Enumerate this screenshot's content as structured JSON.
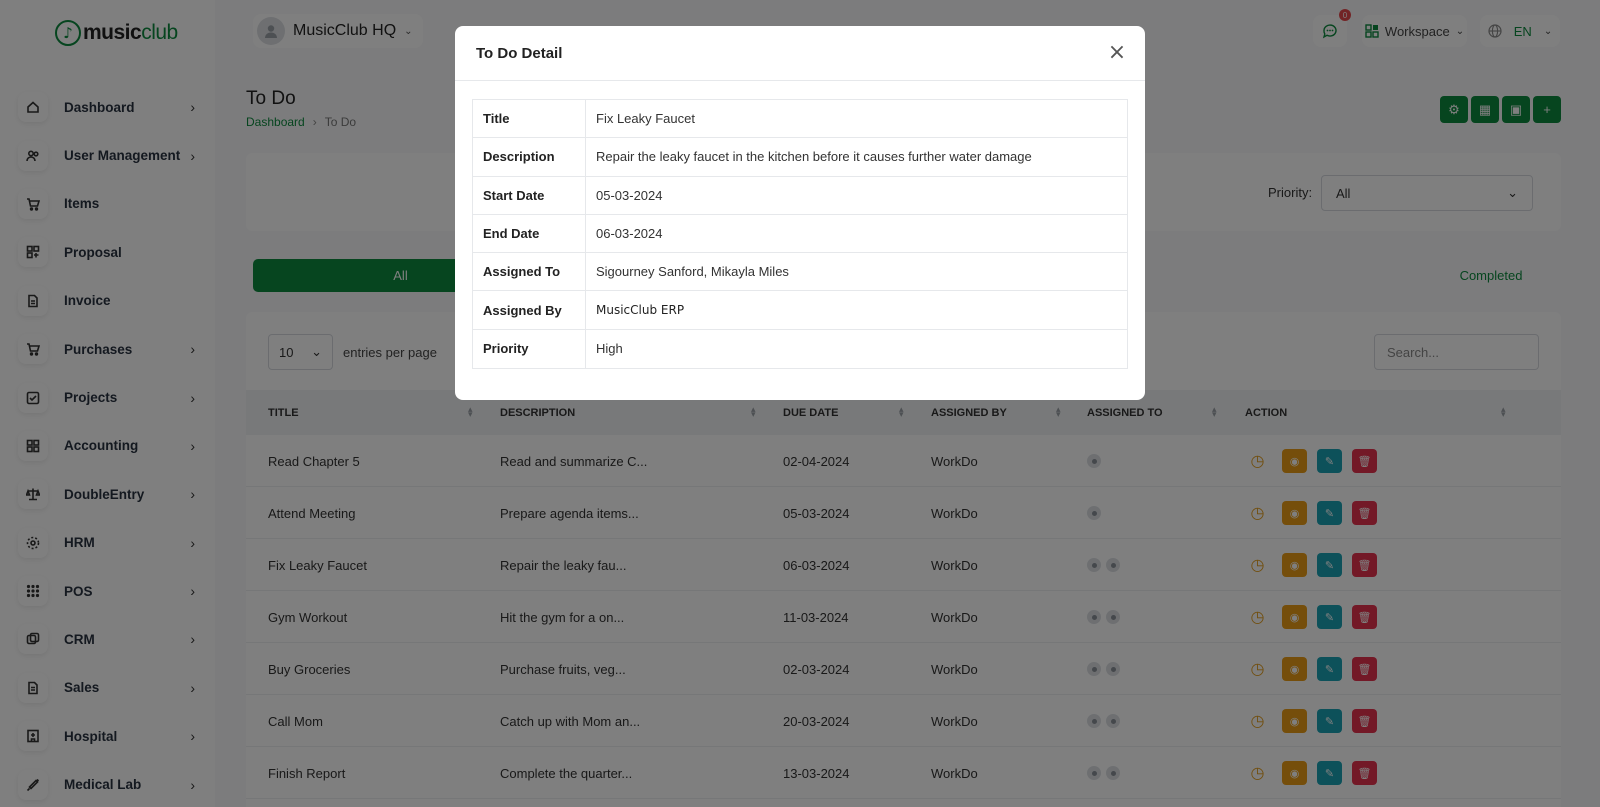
{
  "brand": {
    "logo_part1": "music",
    "logo_part2": "club"
  },
  "header": {
    "workspace_name": "MusicClub HQ",
    "notifications_count": "0",
    "workspace_label": "Workspace",
    "language": "EN"
  },
  "sidebar": {
    "items": [
      {
        "label": "Dashboard",
        "icon": "home-icon",
        "chevron": true
      },
      {
        "label": "User Management",
        "icon": "users-icon",
        "chevron": true
      },
      {
        "label": "Items",
        "icon": "cart-icon",
        "chevron": false
      },
      {
        "label": "Proposal",
        "icon": "proposal-icon",
        "chevron": false
      },
      {
        "label": "Invoice",
        "icon": "invoice-icon",
        "chevron": false
      },
      {
        "label": "Purchases",
        "icon": "cart-icon",
        "chevron": true
      },
      {
        "label": "Projects",
        "icon": "check-square-icon",
        "chevron": true
      },
      {
        "label": "Accounting",
        "icon": "grid-icon",
        "chevron": true
      },
      {
        "label": "DoubleEntry",
        "icon": "scale-icon",
        "chevron": true
      },
      {
        "label": "HRM",
        "icon": "hrm-icon",
        "chevron": true
      },
      {
        "label": "POS",
        "icon": "dots-grid-icon",
        "chevron": true
      },
      {
        "label": "CRM",
        "icon": "crm-icon",
        "chevron": true
      },
      {
        "label": "Sales",
        "icon": "file-icon",
        "chevron": true
      },
      {
        "label": "Hospital",
        "icon": "hospital-icon",
        "chevron": true
      },
      {
        "label": "Medical Lab",
        "icon": "syringe-icon",
        "chevron": true
      }
    ]
  },
  "page": {
    "title": "To Do",
    "breadcrumb": [
      "Dashboard",
      "To Do"
    ]
  },
  "filter": {
    "priority_label": "Priority:",
    "priority_value": "All"
  },
  "tabs": {
    "all": "All",
    "completed": "Completed"
  },
  "table": {
    "entries_value": "10",
    "entries_text": "entries per page",
    "search_placeholder": "Search...",
    "columns": [
      "TITLE",
      "DESCRIPTION",
      "DUE DATE",
      "ASSIGNED BY",
      "ASSIGNED TO",
      "ACTION"
    ],
    "rows": [
      {
        "title": "Read Chapter 5",
        "description": "Read and summarize C...",
        "due": "02-04-2024",
        "by": "WorkDo",
        "assignees": 1
      },
      {
        "title": "Attend Meeting",
        "description": "Prepare agenda items...",
        "due": "05-03-2024",
        "by": "WorkDo",
        "assignees": 1
      },
      {
        "title": "Fix Leaky Faucet",
        "description": "Repair the leaky fau...",
        "due": "06-03-2024",
        "by": "WorkDo",
        "assignees": 2
      },
      {
        "title": "Gym Workout",
        "description": "Hit the gym for a on...",
        "due": "11-03-2024",
        "by": "WorkDo",
        "assignees": 2
      },
      {
        "title": "Buy Groceries",
        "description": "Purchase fruits, veg...",
        "due": "02-03-2024",
        "by": "WorkDo",
        "assignees": 2
      },
      {
        "title": "Call Mom",
        "description": "Catch up with Mom an...",
        "due": "20-03-2024",
        "by": "WorkDo",
        "assignees": 2
      },
      {
        "title": "Finish Report",
        "description": "Complete the quarter...",
        "due": "13-03-2024",
        "by": "WorkDo",
        "assignees": 2
      }
    ]
  },
  "modal": {
    "title": "To Do Detail",
    "fields": [
      {
        "key": "Title",
        "value": "Fix Leaky Faucet"
      },
      {
        "key": "Description",
        "value": "Repair the leaky faucet in the kitchen before it causes further water damage"
      },
      {
        "key": "Start Date",
        "value": "05-03-2024"
      },
      {
        "key": "End Date",
        "value": "06-03-2024"
      },
      {
        "key": "Assigned To",
        "value": "Sigourney Sanford, Mikayla Miles"
      },
      {
        "key": "Assigned By",
        "value": "MusicClub ERP"
      },
      {
        "key": "Priority",
        "value": "High"
      }
    ]
  },
  "colors": {
    "primary": "#0d8b3e",
    "view": "#ea9d16",
    "edit": "#1aa3b4",
    "delete": "#e7334f"
  }
}
